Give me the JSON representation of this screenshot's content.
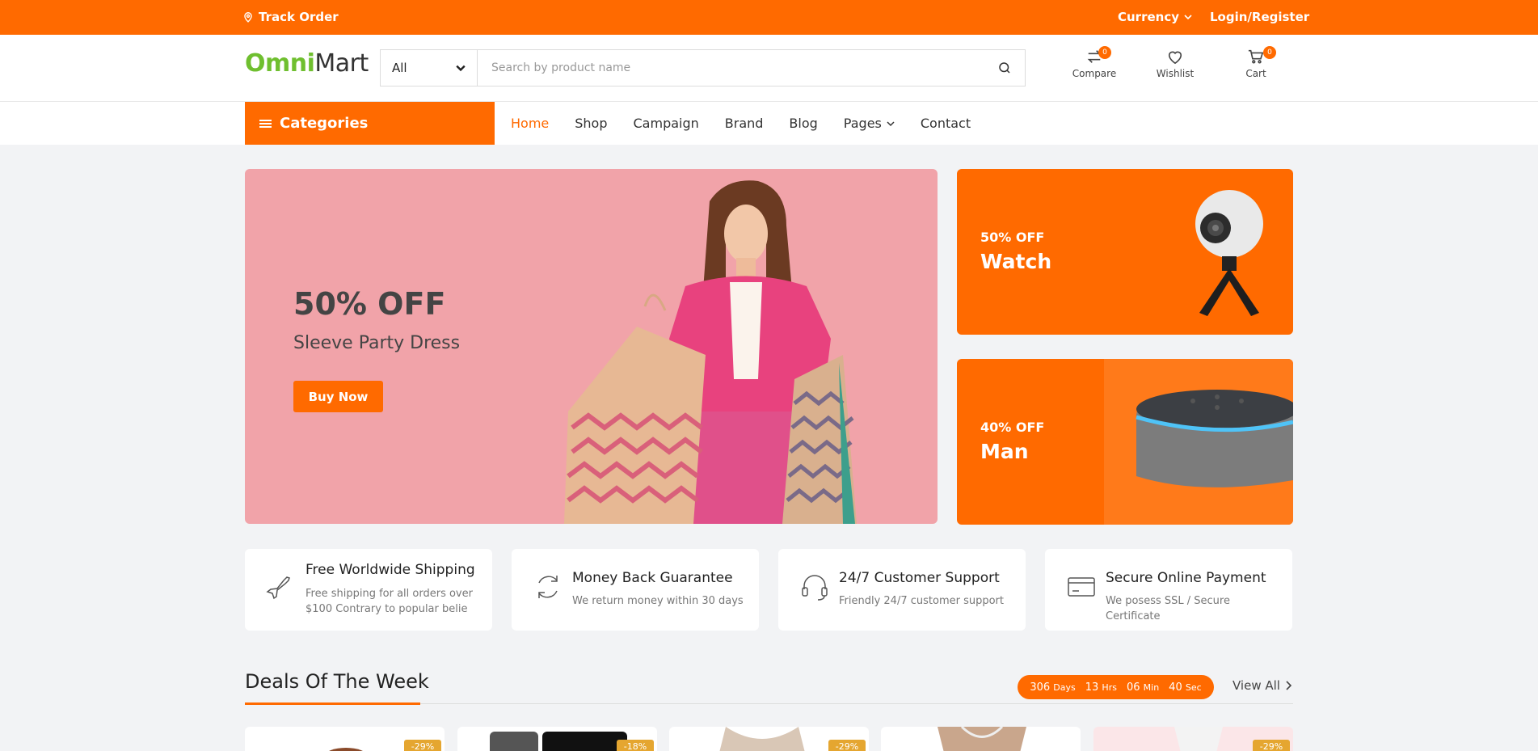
{
  "topbar": {
    "track_label": "Track Order",
    "currency_label": "Currency",
    "login_label": "Login/Register"
  },
  "header": {
    "logo": {
      "part1": "Omni",
      "part2": "Mart"
    },
    "search": {
      "category": "All",
      "placeholder": "Search by product name"
    },
    "icons": [
      {
        "label": "Compare",
        "badge": "0"
      },
      {
        "label": "Wishlist"
      },
      {
        "label": "Cart",
        "badge": "0"
      }
    ]
  },
  "nav": {
    "categories_label": "Categories",
    "links": [
      "Home",
      "Shop",
      "Campaign",
      "Brand",
      "Blog",
      "Pages",
      "Contact"
    ]
  },
  "hero": {
    "headline": "50% OFF",
    "subtitle": "Sleeve Party Dress",
    "button": "Buy Now"
  },
  "promos": [
    {
      "off": "50% OFF",
      "name": "Watch"
    },
    {
      "off": "40% OFF",
      "name": "Man"
    }
  ],
  "features": [
    {
      "title": "Free Worldwide Shipping",
      "desc": "Free shipping for all orders over $100 Contrary to popular belie"
    },
    {
      "title": "Money Back Guarantee",
      "desc": "We return money within 30 days"
    },
    {
      "title": "24/7 Customer Support",
      "desc": "Friendly 24/7 customer support"
    },
    {
      "title": "Secure Online Payment",
      "desc": "We posess SSL / Secure Certificate"
    }
  ],
  "deals": {
    "title": "Deals Of The Week",
    "timer": {
      "days": "306",
      "days_unit": "Days",
      "hrs": "13",
      "hrs_unit": "Hrs",
      "min": "06",
      "min_unit": "Min",
      "sec": "40",
      "sec_unit": "Sec"
    },
    "view_all": "View All",
    "discounts": [
      "-29%",
      "-18%",
      "-29%",
      "",
      "-29%"
    ]
  },
  "colors": {
    "accent": "#ff6a00",
    "hero_bg": "#f1a3a9",
    "logo_green": "#6fbf2f"
  }
}
